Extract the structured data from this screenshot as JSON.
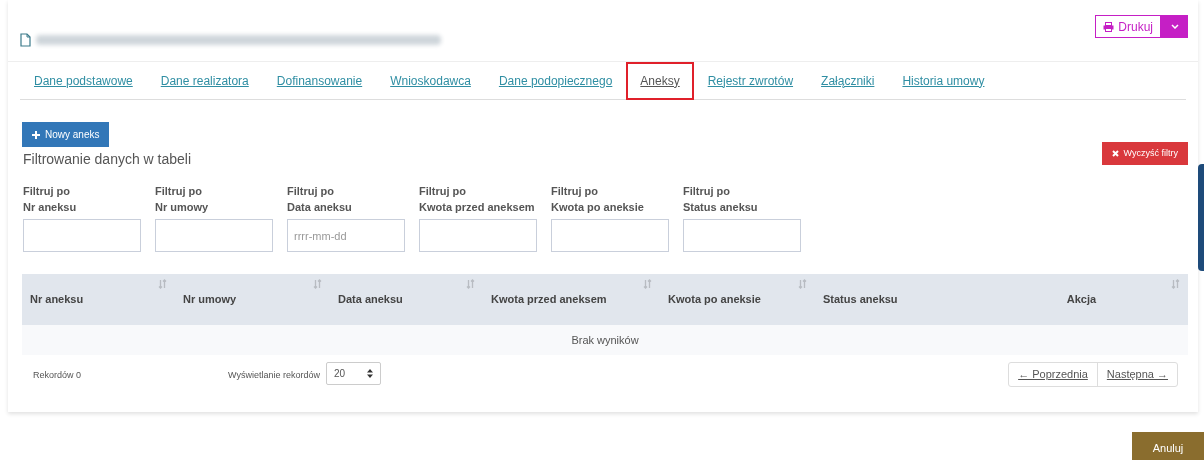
{
  "header": {
    "title_redacted": true,
    "print_button": {
      "label": "Drukuj"
    }
  },
  "tabs": [
    {
      "label": "Dane podstawowe",
      "selected": false
    },
    {
      "label": "Dane realizatora",
      "selected": false
    },
    {
      "label": "Dofinansowanie",
      "selected": false
    },
    {
      "label": "Wnioskodawca",
      "selected": false
    },
    {
      "label": "Dane podopiecznego",
      "selected": false
    },
    {
      "label": "Aneksy",
      "selected": true
    },
    {
      "label": "Rejestr zwrotów",
      "selected": false
    },
    {
      "label": "Załączniki",
      "selected": false
    },
    {
      "label": "Historia umowy",
      "selected": false
    }
  ],
  "new_button": {
    "label": "Nowy aneks"
  },
  "filter_section": {
    "title": "Filtrowanie danych w tabeli",
    "clear_button": "Wyczyść filtry",
    "filters": [
      {
        "prefix": "Filtruj po",
        "label": "Nr aneksu"
      },
      {
        "prefix": "Filtruj po",
        "label": "Nr umowy"
      },
      {
        "prefix": "Filtruj po",
        "label": "Data aneksu",
        "placeholder": "rrrr-mm-dd"
      },
      {
        "prefix": "Filtruj po",
        "label": "Kwota przed aneksem"
      },
      {
        "prefix": "Filtruj po",
        "label": "Kwota po aneksie"
      },
      {
        "prefix": "Filtruj po",
        "label": "Status aneksu"
      }
    ]
  },
  "table": {
    "columns": [
      {
        "label": "Nr aneksu",
        "sortable": true
      },
      {
        "label": "Nr umowy",
        "sortable": true
      },
      {
        "label": "Data aneksu",
        "sortable": true
      },
      {
        "label": "Kwota przed aneksem",
        "sortable": true
      },
      {
        "label": "Kwota po aneksie",
        "sortable": true
      },
      {
        "label": "Status aneksu",
        "sortable": false
      },
      {
        "label": "Akcja",
        "sortable": true
      }
    ],
    "empty_message": "Brak wyników"
  },
  "footer": {
    "records": "Rekordów 0",
    "page_size_label": "Wyświetlanie rekordów",
    "page_size": "20",
    "prev": "← Poprzednia",
    "next": "Następna →"
  },
  "cancel_button": "Anuluj"
}
